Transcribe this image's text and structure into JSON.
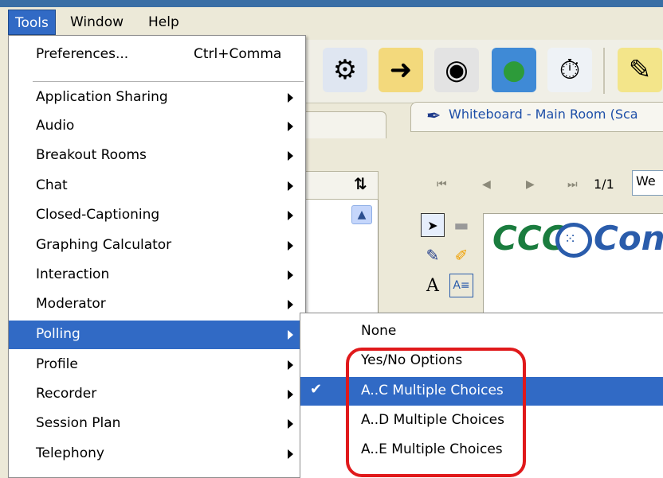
{
  "menubar": {
    "items": [
      {
        "label": "Tools",
        "active": true
      },
      {
        "label": "Window",
        "active": false
      },
      {
        "label": "Help",
        "active": false
      }
    ]
  },
  "tools_menu": {
    "preferences": {
      "label": "Preferences...",
      "shortcut": "Ctrl+Comma"
    },
    "items": [
      {
        "label": "Application Sharing",
        "submenu": true
      },
      {
        "label": "Audio",
        "submenu": true
      },
      {
        "label": "Breakout Rooms",
        "submenu": true
      },
      {
        "label": "Chat",
        "submenu": true
      },
      {
        "label": "Closed-Captioning",
        "submenu": true
      },
      {
        "label": "Graphing Calculator",
        "submenu": true
      },
      {
        "label": "Interaction",
        "submenu": true
      },
      {
        "label": "Moderator",
        "submenu": true
      },
      {
        "label": "Polling",
        "submenu": true,
        "highlighted": true
      },
      {
        "label": "Profile",
        "submenu": true
      },
      {
        "label": "Recorder",
        "submenu": true
      },
      {
        "label": "Session Plan",
        "submenu": true
      },
      {
        "label": "Telephony",
        "submenu": true
      }
    ]
  },
  "polling_submenu": {
    "items": [
      {
        "label": "None",
        "checked": false,
        "highlighted": false
      },
      {
        "label": "Yes/No Options",
        "checked": false,
        "highlighted": false
      },
      {
        "label": "A..C Multiple Choices",
        "checked": true,
        "highlighted": true
      },
      {
        "label": "A..D Multiple Choices",
        "checked": false,
        "highlighted": false
      },
      {
        "label": "A..E Multiple Choices",
        "checked": false,
        "highlighted": false
      }
    ],
    "check_glyph": "✔"
  },
  "whiteboard": {
    "title": "Whiteboard - Main Room (Sca",
    "page_indicator": "1/1",
    "page_select_value": "We",
    "logo_prefix": "CCC",
    "logo_suffix": "Con"
  },
  "left_panel": {
    "sort_glyph": "⇅"
  },
  "colors": {
    "menu_highlight": "#316ac5",
    "annotation": "#e0191b",
    "window_bg": "#ece9d8"
  }
}
